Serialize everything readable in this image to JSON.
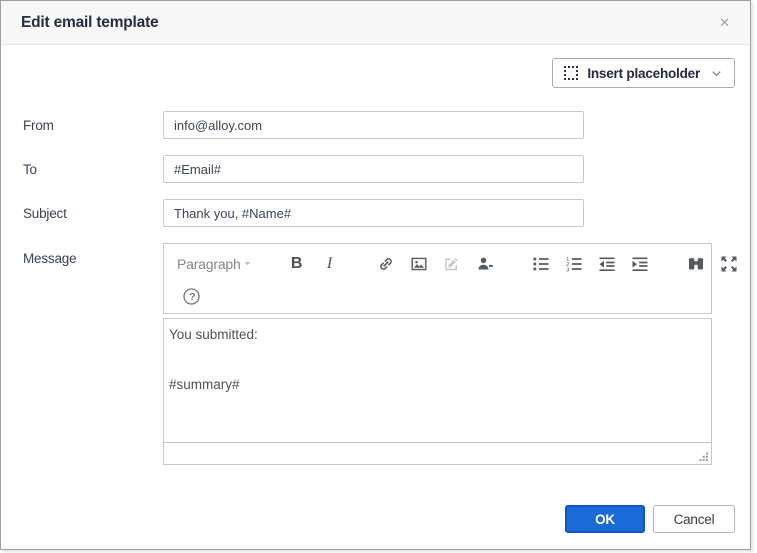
{
  "dialog": {
    "title": "Edit email template",
    "close_label": "✕"
  },
  "actions": {
    "insert_placeholder_label": "Insert placeholder"
  },
  "form": {
    "fields": [
      {
        "label": "From",
        "value": "info@alloy.com"
      },
      {
        "label": "To",
        "value": "#Email#"
      },
      {
        "label": "Subject",
        "value": "Thank you, #Name#"
      }
    ],
    "message_label": "Message"
  },
  "editor": {
    "format_label": "Paragraph",
    "bold_label": "B",
    "italic_label": "I",
    "help_label": "?",
    "message_text": "You submitted:\n\n#summary#"
  },
  "footer": {
    "ok_label": "OK",
    "cancel_label": "Cancel"
  },
  "colors": {
    "accent_blue": "#1b6ad9",
    "accent_blue_border": "#0f55c5",
    "title_text": "#272c44",
    "toolbar_icon_gray": "#565b61",
    "disabled_icon_gray": "#c3c7cb",
    "input_border": "#c9c9c9"
  }
}
